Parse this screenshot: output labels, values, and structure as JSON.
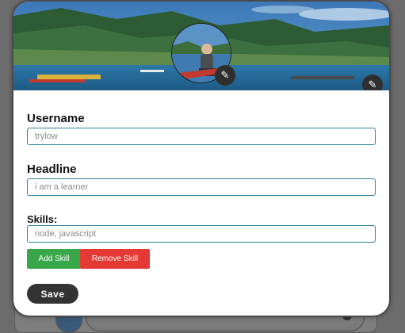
{
  "profile_modal": {
    "cover_edit_icon": "pencil-icon",
    "avatar_edit_icon": "pencil-icon"
  },
  "form": {
    "username_label": "Username",
    "username_placeholder": "trylow",
    "headline_label": "Headline",
    "headline_placeholder": "i am a learner",
    "skills_label": "Skills:",
    "skills_placeholder": "node, javascript",
    "add_skill_label": "Add Skill",
    "remove_skill_label": "Remove Skill",
    "save_label": "Save"
  },
  "colors": {
    "add_button": "#3aa64a",
    "remove_button": "#e53935",
    "save_button": "#333333",
    "input_border": "#2f7f9f"
  }
}
